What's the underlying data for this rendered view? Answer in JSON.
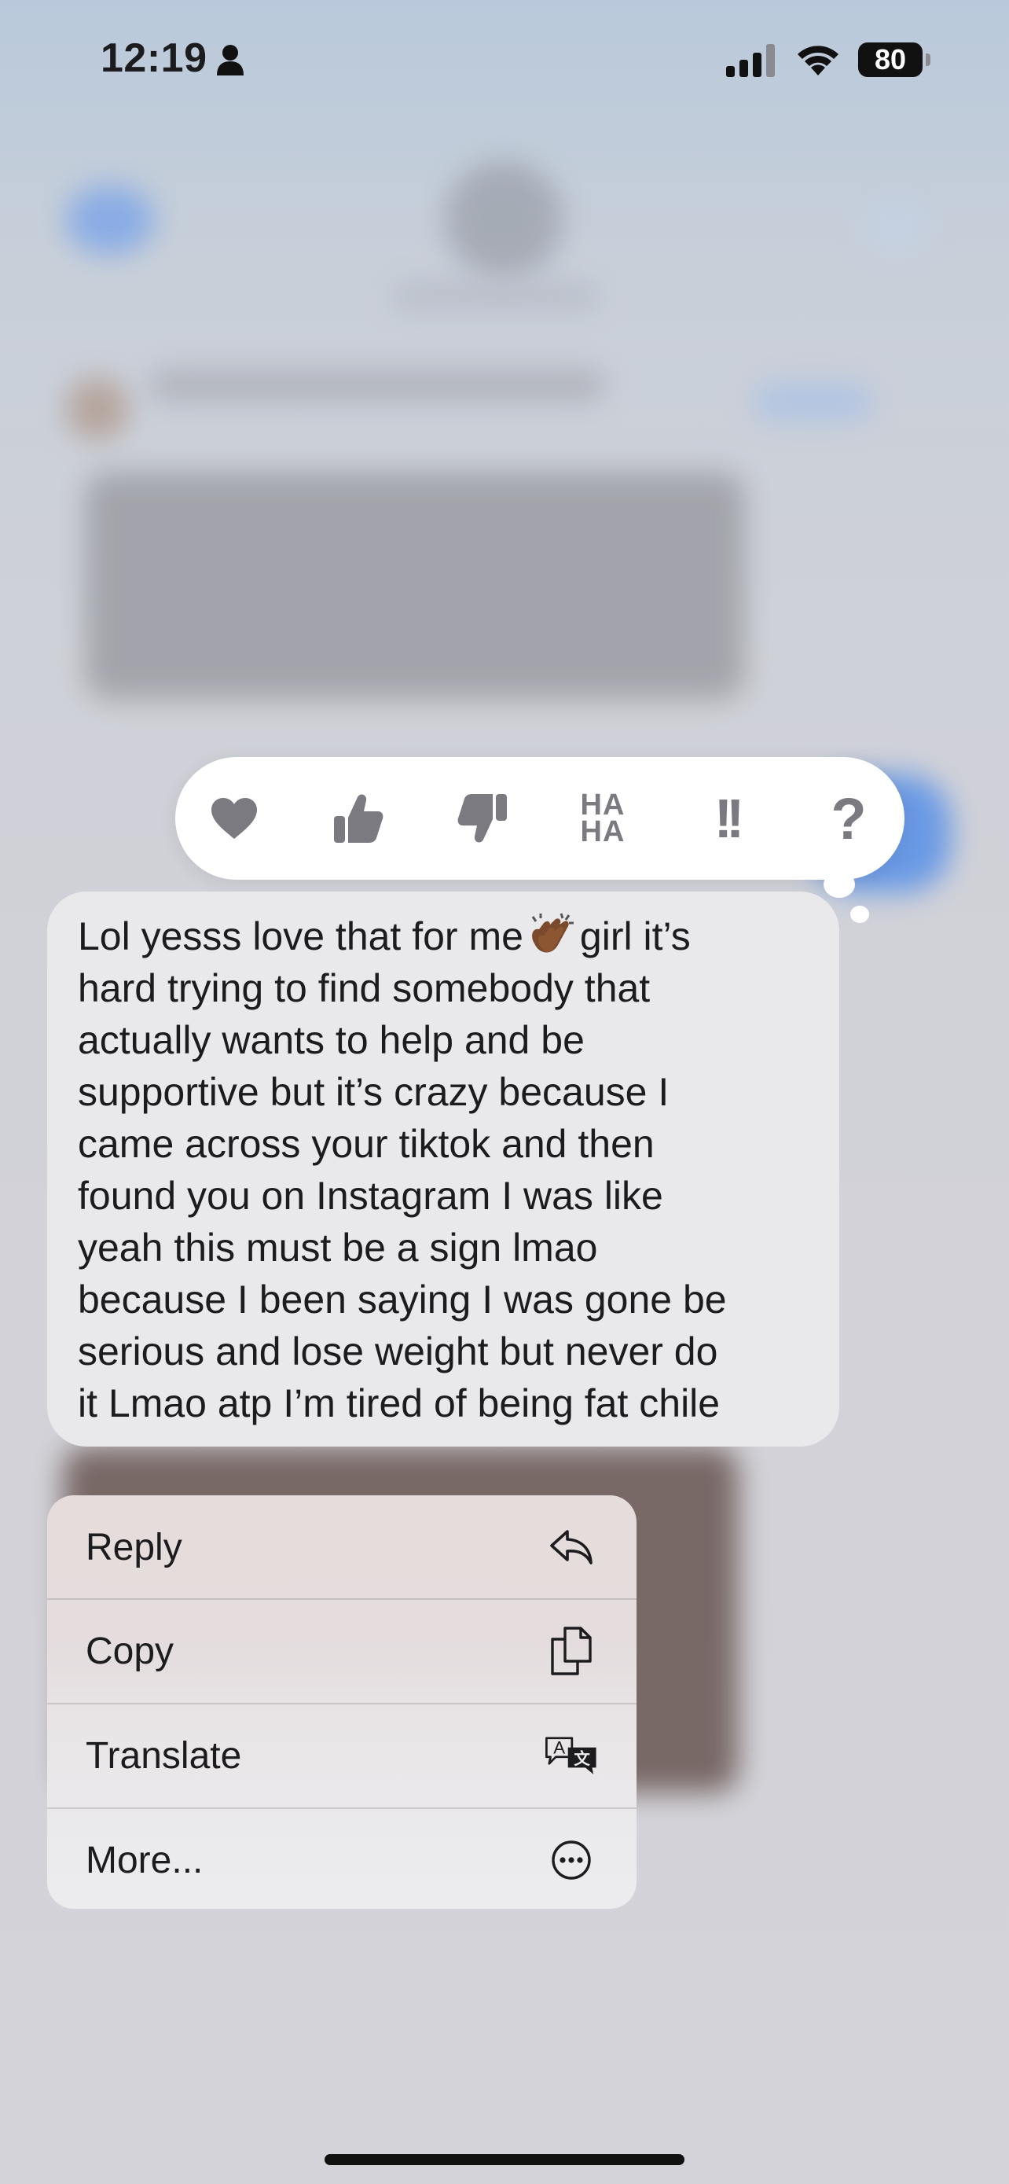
{
  "status_bar": {
    "time": "12:19",
    "battery": "80",
    "icons": [
      "person-icon",
      "signal-icon",
      "wifi-icon",
      "battery-icon"
    ]
  },
  "reactions": [
    {
      "name": "heart",
      "icon": "heart-icon"
    },
    {
      "name": "thumbs-up",
      "icon": "thumbs-up-icon"
    },
    {
      "name": "thumbs-down",
      "icon": "thumbs-down-icon"
    },
    {
      "name": "haha",
      "line1": "HA",
      "line2": "HA"
    },
    {
      "name": "emphasize",
      "text": "!!"
    },
    {
      "name": "question",
      "text": "?"
    }
  ],
  "message": {
    "lines": [
      "Lol yesss love that for me",
      "girl it’s",
      "hard trying to find somebody that",
      "actually wants to help and be",
      "supportive but it’s crazy because I",
      "came across your tiktok and then",
      "found you on Instagram I was like",
      "yeah this must be a sign lmao",
      "because I been saying I was gone be",
      "serious and lose weight but never do",
      "it Lmao atp I’m tired of being fat chile"
    ],
    "emoji": "clapping-hands-emoji"
  },
  "menu": {
    "items": [
      {
        "label": "Reply",
        "icon": "reply-icon"
      },
      {
        "label": "Copy",
        "icon": "copy-icon"
      },
      {
        "label": "Translate",
        "icon": "translate-icon"
      },
      {
        "label": "More...",
        "icon": "more-icon"
      }
    ]
  },
  "colors": {
    "reaction_icon": "#7a7a80",
    "bubble": "#e9e9eb",
    "text": "#1c1c1e"
  }
}
